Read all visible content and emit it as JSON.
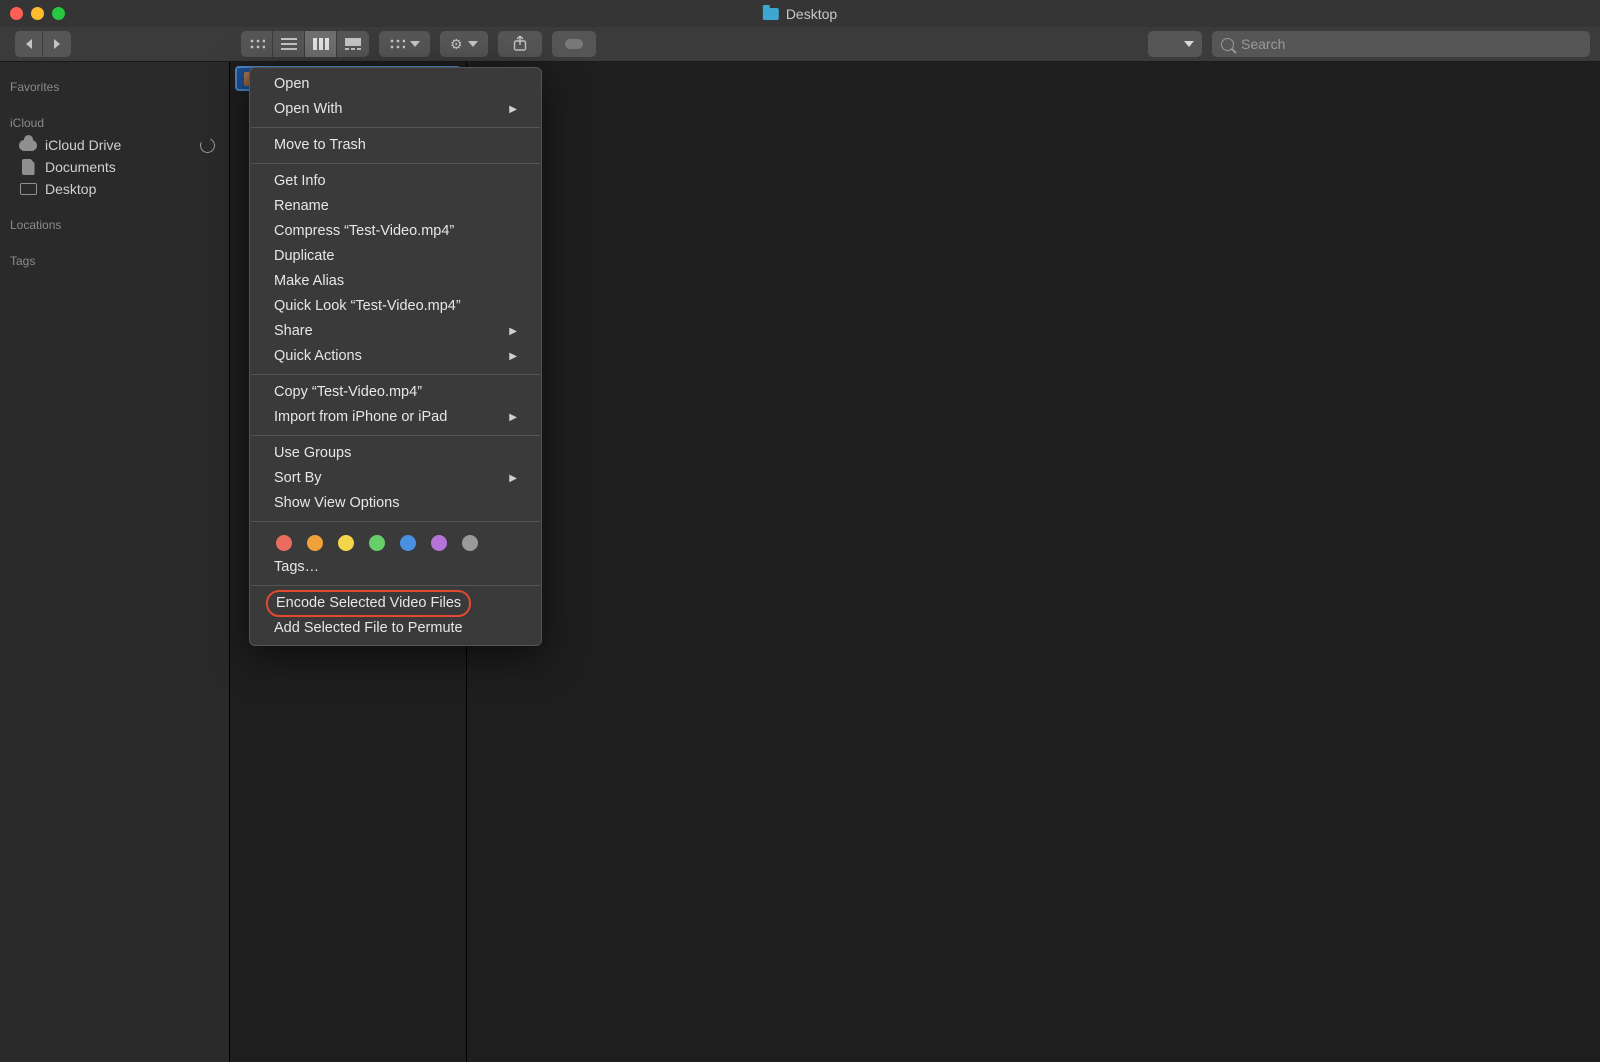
{
  "window": {
    "title": "Desktop"
  },
  "search": {
    "placeholder": "Search"
  },
  "sidebar": {
    "sections": [
      {
        "header": "Favorites",
        "items": []
      },
      {
        "header": "iCloud",
        "items": [
          {
            "icon": "cloud",
            "label": "iCloud Drive",
            "trailing": "progress"
          },
          {
            "icon": "doc",
            "label": "Documents"
          },
          {
            "icon": "desk",
            "label": "Desktop"
          }
        ]
      },
      {
        "header": "Locations",
        "items": []
      },
      {
        "header": "Tags",
        "items": []
      }
    ]
  },
  "selected_file": {
    "name": "Test-Video.mp4"
  },
  "context_menu": {
    "groups": [
      [
        {
          "label": "Open"
        },
        {
          "label": "Open With",
          "submenu": true
        }
      ],
      [
        {
          "label": "Move to Trash"
        }
      ],
      [
        {
          "label": "Get Info"
        },
        {
          "label": "Rename"
        },
        {
          "label": "Compress “Test-Video.mp4”"
        },
        {
          "label": "Duplicate"
        },
        {
          "label": "Make Alias"
        },
        {
          "label": "Quick Look “Test-Video.mp4”"
        },
        {
          "label": "Share",
          "submenu": true
        },
        {
          "label": "Quick Actions",
          "submenu": true
        }
      ],
      [
        {
          "label": "Copy “Test-Video.mp4”"
        },
        {
          "label": "Import from iPhone or iPad",
          "submenu": true
        }
      ],
      [
        {
          "label": "Use Groups"
        },
        {
          "label": "Sort By",
          "submenu": true
        },
        {
          "label": "Show View Options"
        }
      ],
      [
        {
          "tags": [
            "#e96d5f",
            "#f0a13a",
            "#f4d54a",
            "#67cf6a",
            "#4a90e2",
            "#b574d8",
            "#9a9a9a"
          ],
          "tags_label": "Tags…"
        }
      ],
      [
        {
          "label": "Encode Selected Video Files",
          "highlight": true
        },
        {
          "label": "Add Selected File to Permute"
        }
      ]
    ]
  }
}
